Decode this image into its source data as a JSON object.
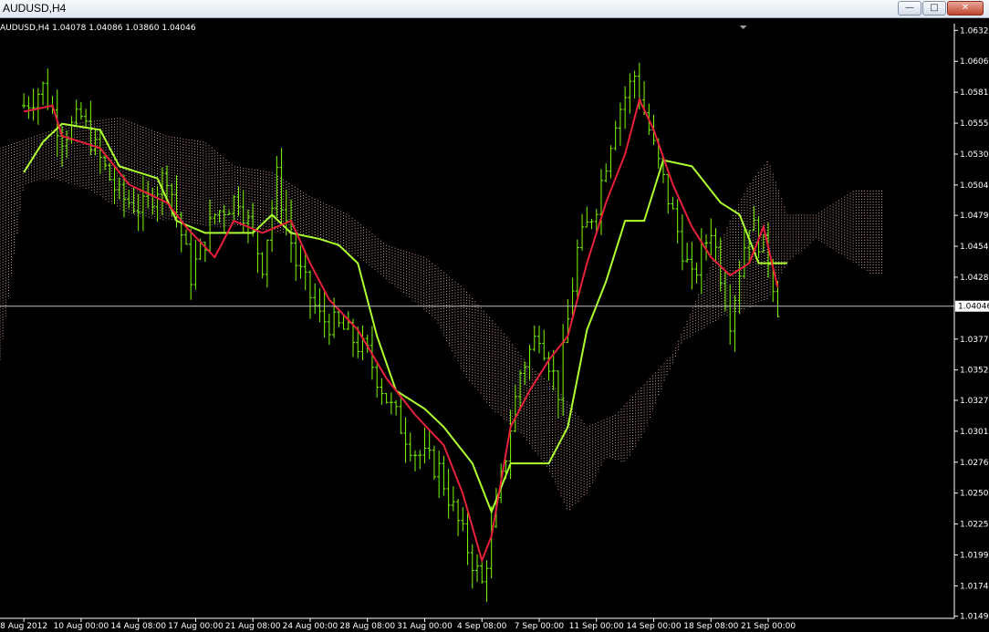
{
  "window": {
    "title": "AUDUSD,H4",
    "minimize_icon": "minimize-icon",
    "maximize_icon": "maximize-icon",
    "close_icon": "close-icon"
  },
  "info_line": "AUDUSD,H4  1.04078 1.04086 1.03860 1.04046",
  "colors": {
    "background": "#000000",
    "candles": "#7CFC00",
    "tenkan": "#e8213a",
    "kijun": "#adff2f",
    "cloud": "#f5c6b0",
    "current_price_line": "#c0c0c0",
    "grid_text": "#ffffff"
  },
  "chart_data": {
    "type": "line",
    "symbol": "AUDUSD",
    "timeframe": "H4",
    "ohlc_last": {
      "open": 1.04078,
      "high": 1.04086,
      "low": 1.0386,
      "close": 1.04046
    },
    "current_price_label": "1.04046",
    "ylim": [
      1.0148,
      1.0636
    ],
    "y_ticks": [
      1.0632,
      1.06065,
      1.0581,
      1.05555,
      1.053,
      1.05045,
      1.04795,
      1.0454,
      1.04285,
      1.03775,
      1.0352,
      1.0327,
      1.03015,
      1.0276,
      1.02505,
      1.0225,
      1.01995,
      1.0174,
      1.0149
    ],
    "y_tick_labels": [
      "1.06320",
      "1.06065",
      "1.05810",
      "1.05555",
      "1.05300",
      "1.05045",
      "1.04795",
      "1.04540",
      "1.04285",
      "1.03775",
      "1.03520",
      "1.03270",
      "1.03015",
      "1.02760",
      "1.02505",
      "1.02250",
      "1.01995",
      "1.01740",
      "1.01490"
    ],
    "x_ticks": [
      0,
      12,
      24,
      36,
      48,
      60,
      72,
      84,
      96,
      108,
      120,
      132,
      144,
      156
    ],
    "x_tick_labels": [
      "8 Aug 2012",
      "10 Aug 00:00",
      "14 Aug 08:00",
      "17 Aug 00:00",
      "21 Aug 08:00",
      "24 Aug 00:00",
      "28 Aug 08:00",
      "31 Aug 00:00",
      "4 Sep 08:00",
      "7 Sep 00:00",
      "11 Sep 00:00",
      "14 Sep 00:00",
      "18 Sep 08:00",
      "21 Sep 00:00"
    ],
    "xlim": [
      -5,
      195
    ],
    "price_anchors": [
      {
        "x": 0,
        "y": 1.057
      },
      {
        "x": 4,
        "y": 1.0585
      },
      {
        "x": 8,
        "y": 1.0545
      },
      {
        "x": 12,
        "y": 1.056
      },
      {
        "x": 16,
        "y": 1.0525
      },
      {
        "x": 20,
        "y": 1.0495
      },
      {
        "x": 25,
        "y": 1.0485
      },
      {
        "x": 30,
        "y": 1.0515
      },
      {
        "x": 35,
        "y": 1.043
      },
      {
        "x": 40,
        "y": 1.048
      },
      {
        "x": 45,
        "y": 1.0495
      },
      {
        "x": 50,
        "y": 1.044
      },
      {
        "x": 53,
        "y": 1.051
      },
      {
        "x": 57,
        "y": 1.044
      },
      {
        "x": 62,
        "y": 1.0395
      },
      {
        "x": 67,
        "y": 1.0385
      },
      {
        "x": 72,
        "y": 1.0365
      },
      {
        "x": 77,
        "y": 1.032
      },
      {
        "x": 82,
        "y": 1.0285
      },
      {
        "x": 87,
        "y": 1.027
      },
      {
        "x": 92,
        "y": 1.0215
      },
      {
        "x": 96,
        "y": 1.0175
      },
      {
        "x": 100,
        "y": 1.026
      },
      {
        "x": 104,
        "y": 1.035
      },
      {
        "x": 108,
        "y": 1.0385
      },
      {
        "x": 112,
        "y": 1.0335
      },
      {
        "x": 116,
        "y": 1.045
      },
      {
        "x": 120,
        "y": 1.049
      },
      {
        "x": 124,
        "y": 1.056
      },
      {
        "x": 128,
        "y": 1.0595
      },
      {
        "x": 132,
        "y": 1.0535
      },
      {
        "x": 136,
        "y": 1.048
      },
      {
        "x": 140,
        "y": 1.0425
      },
      {
        "x": 144,
        "y": 1.047
      },
      {
        "x": 148,
        "y": 1.0395
      },
      {
        "x": 152,
        "y": 1.0475
      },
      {
        "x": 156,
        "y": 1.0445
      },
      {
        "x": 158,
        "y": 1.0405
      }
    ],
    "series": [
      {
        "key": "tenkan",
        "points": [
          {
            "x": 0,
            "y": 1.0565
          },
          {
            "x": 6,
            "y": 1.057
          },
          {
            "x": 8,
            "y": 1.0545
          },
          {
            "x": 16,
            "y": 1.0535
          },
          {
            "x": 22,
            "y": 1.0505
          },
          {
            "x": 30,
            "y": 1.049
          },
          {
            "x": 34,
            "y": 1.047
          },
          {
            "x": 40,
            "y": 1.0445
          },
          {
            "x": 44,
            "y": 1.0475
          },
          {
            "x": 50,
            "y": 1.0465
          },
          {
            "x": 56,
            "y": 1.0475
          },
          {
            "x": 60,
            "y": 1.044
          },
          {
            "x": 64,
            "y": 1.041
          },
          {
            "x": 70,
            "y": 1.0385
          },
          {
            "x": 76,
            "y": 1.0345
          },
          {
            "x": 82,
            "y": 1.0315
          },
          {
            "x": 88,
            "y": 1.029
          },
          {
            "x": 92,
            "y": 1.025
          },
          {
            "x": 96,
            "y": 1.0195
          },
          {
            "x": 98,
            "y": 1.0215
          },
          {
            "x": 102,
            "y": 1.0305
          },
          {
            "x": 106,
            "y": 1.0335
          },
          {
            "x": 110,
            "y": 1.036
          },
          {
            "x": 114,
            "y": 1.038
          },
          {
            "x": 118,
            "y": 1.044
          },
          {
            "x": 122,
            "y": 1.049
          },
          {
            "x": 126,
            "y": 1.053
          },
          {
            "x": 129,
            "y": 1.0575
          },
          {
            "x": 132,
            "y": 1.055
          },
          {
            "x": 136,
            "y": 1.0505
          },
          {
            "x": 140,
            "y": 1.047
          },
          {
            "x": 144,
            "y": 1.0445
          },
          {
            "x": 148,
            "y": 1.043
          },
          {
            "x": 152,
            "y": 1.044
          },
          {
            "x": 155,
            "y": 1.047
          },
          {
            "x": 158,
            "y": 1.042
          }
        ]
      },
      {
        "key": "kijun",
        "points": [
          {
            "x": 0,
            "y": 1.0515
          },
          {
            "x": 4,
            "y": 1.054
          },
          {
            "x": 8,
            "y": 1.0555
          },
          {
            "x": 16,
            "y": 1.055
          },
          {
            "x": 20,
            "y": 1.052
          },
          {
            "x": 28,
            "y": 1.051
          },
          {
            "x": 32,
            "y": 1.0475
          },
          {
            "x": 38,
            "y": 1.0465
          },
          {
            "x": 48,
            "y": 1.0465
          },
          {
            "x": 52,
            "y": 1.048
          },
          {
            "x": 56,
            "y": 1.0465
          },
          {
            "x": 62,
            "y": 1.046
          },
          {
            "x": 66,
            "y": 1.0455
          },
          {
            "x": 70,
            "y": 1.044
          },
          {
            "x": 74,
            "y": 1.038
          },
          {
            "x": 78,
            "y": 1.0335
          },
          {
            "x": 84,
            "y": 1.032
          },
          {
            "x": 88,
            "y": 1.0305
          },
          {
            "x": 94,
            "y": 1.0275
          },
          {
            "x": 98,
            "y": 1.0235
          },
          {
            "x": 102,
            "y": 1.0275
          },
          {
            "x": 110,
            "y": 1.0275
          },
          {
            "x": 114,
            "y": 1.0305
          },
          {
            "x": 118,
            "y": 1.0385
          },
          {
            "x": 122,
            "y": 1.0425
          },
          {
            "x": 126,
            "y": 1.0475
          },
          {
            "x": 130,
            "y": 1.0475
          },
          {
            "x": 134,
            "y": 1.0525
          },
          {
            "x": 140,
            "y": 1.052
          },
          {
            "x": 146,
            "y": 1.049
          },
          {
            "x": 150,
            "y": 1.048
          },
          {
            "x": 154,
            "y": 1.044
          },
          {
            "x": 160,
            "y": 1.044
          }
        ]
      },
      {
        "key": "cloud_upper",
        "points": [
          {
            "x": -5,
            "y": 1.0535
          },
          {
            "x": 10,
            "y": 1.0555
          },
          {
            "x": 20,
            "y": 1.056
          },
          {
            "x": 30,
            "y": 1.0545
          },
          {
            "x": 38,
            "y": 1.054
          },
          {
            "x": 44,
            "y": 1.052
          },
          {
            "x": 52,
            "y": 1.0515
          },
          {
            "x": 60,
            "y": 1.0495
          },
          {
            "x": 68,
            "y": 1.048
          },
          {
            "x": 76,
            "y": 1.0455
          },
          {
            "x": 84,
            "y": 1.0445
          },
          {
            "x": 92,
            "y": 1.042
          },
          {
            "x": 100,
            "y": 1.0385
          },
          {
            "x": 106,
            "y": 1.0355
          },
          {
            "x": 112,
            "y": 1.0335
          },
          {
            "x": 118,
            "y": 1.0305
          },
          {
            "x": 124,
            "y": 1.0315
          },
          {
            "x": 130,
            "y": 1.034
          },
          {
            "x": 136,
            "y": 1.0365
          },
          {
            "x": 142,
            "y": 1.042
          },
          {
            "x": 148,
            "y": 1.0475
          },
          {
            "x": 152,
            "y": 1.0505
          },
          {
            "x": 156,
            "y": 1.0525
          },
          {
            "x": 160,
            "y": 1.048
          },
          {
            "x": 166,
            "y": 1.048
          },
          {
            "x": 174,
            "y": 1.05
          },
          {
            "x": 180,
            "y": 1.05
          }
        ]
      },
      {
        "key": "cloud_lower",
        "points": [
          {
            "x": -5,
            "y": 1.036
          },
          {
            "x": 0,
            "y": 1.0505
          },
          {
            "x": 6,
            "y": 1.051
          },
          {
            "x": 14,
            "y": 1.05
          },
          {
            "x": 22,
            "y": 1.048
          },
          {
            "x": 30,
            "y": 1.0475
          },
          {
            "x": 38,
            "y": 1.047
          },
          {
            "x": 46,
            "y": 1.047
          },
          {
            "x": 54,
            "y": 1.0465
          },
          {
            "x": 62,
            "y": 1.046
          },
          {
            "x": 70,
            "y": 1.0445
          },
          {
            "x": 78,
            "y": 1.042
          },
          {
            "x": 86,
            "y": 1.0395
          },
          {
            "x": 92,
            "y": 1.035
          },
          {
            "x": 98,
            "y": 1.032
          },
          {
            "x": 104,
            "y": 1.03
          },
          {
            "x": 110,
            "y": 1.027
          },
          {
            "x": 114,
            "y": 1.0235
          },
          {
            "x": 118,
            "y": 1.025
          },
          {
            "x": 122,
            "y": 1.028
          },
          {
            "x": 126,
            "y": 1.0275
          },
          {
            "x": 130,
            "y": 1.03
          },
          {
            "x": 134,
            "y": 1.034
          },
          {
            "x": 138,
            "y": 1.0375
          },
          {
            "x": 142,
            "y": 1.0385
          },
          {
            "x": 146,
            "y": 1.0395
          },
          {
            "x": 150,
            "y": 1.04
          },
          {
            "x": 156,
            "y": 1.041
          },
          {
            "x": 160,
            "y": 1.044
          },
          {
            "x": 166,
            "y": 1.046
          },
          {
            "x": 172,
            "y": 1.0445
          },
          {
            "x": 178,
            "y": 1.043
          },
          {
            "x": 180,
            "y": 1.043
          }
        ]
      }
    ],
    "grid": false
  }
}
